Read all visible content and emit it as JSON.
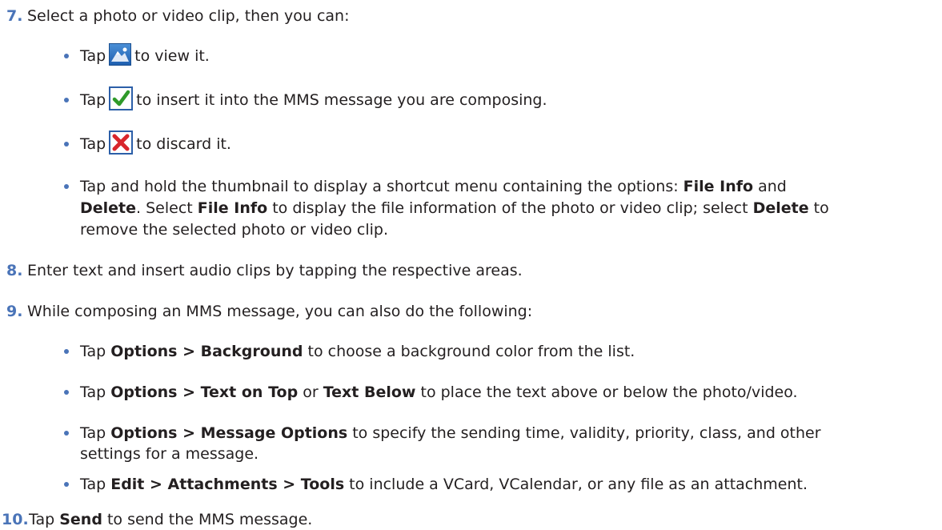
{
  "step7": {
    "num": "7.",
    "text": "Select a photo or video clip, then you can:"
  },
  "b1": {
    "pre": "Tap",
    "post": "to view it.",
    "icon": "view-photo-icon"
  },
  "b2": {
    "pre": "Tap",
    "post": "to insert it into the MMS message you are composing.",
    "icon": "checkmark-icon"
  },
  "b3": {
    "pre": "Tap",
    "post": "to discard it.",
    "icon": "discard-x-icon"
  },
  "b4": {
    "l1_a": "Tap and hold the thumbnail to display a shortcut menu containing the options: ",
    "l1_b": "File Info",
    "l1_c": " and",
    "l2_a": "Delete",
    "l2_b": ". Select ",
    "l2_c": "File Info",
    "l2_d": " to display the file information of the photo or video clip; select ",
    "l2_e": "Delete",
    "l2_f": " to",
    "l3": "remove the selected photo or video clip."
  },
  "step8": {
    "num": "8.",
    "text": "Enter text and insert audio clips by tapping the respective areas."
  },
  "step9": {
    "num": "9.",
    "text": "While composing an MMS message, you can also do the following:"
  },
  "b5": {
    "a": "Tap ",
    "b": "Options > Background",
    "c": " to choose a background color from the list."
  },
  "b6": {
    "a": "Tap ",
    "b": "Options > Text on Top",
    "c": " or ",
    "d": "Text Below",
    "e": " to place the text above or below the photo/video."
  },
  "b7": {
    "a": "Tap ",
    "b": "Options > Message Options",
    "c": " to specify the sending time, validity, priority, class, and other",
    "l2": "settings for a message."
  },
  "b8": {
    "a": "Tap ",
    "b": "Edit > Attachments > Tools",
    "c": " to include a VCard, VCalendar, or any file as an attachment."
  },
  "step10": {
    "num": "10.",
    "a": "Tap ",
    "b": "Send",
    "c": " to send the MMS message."
  }
}
